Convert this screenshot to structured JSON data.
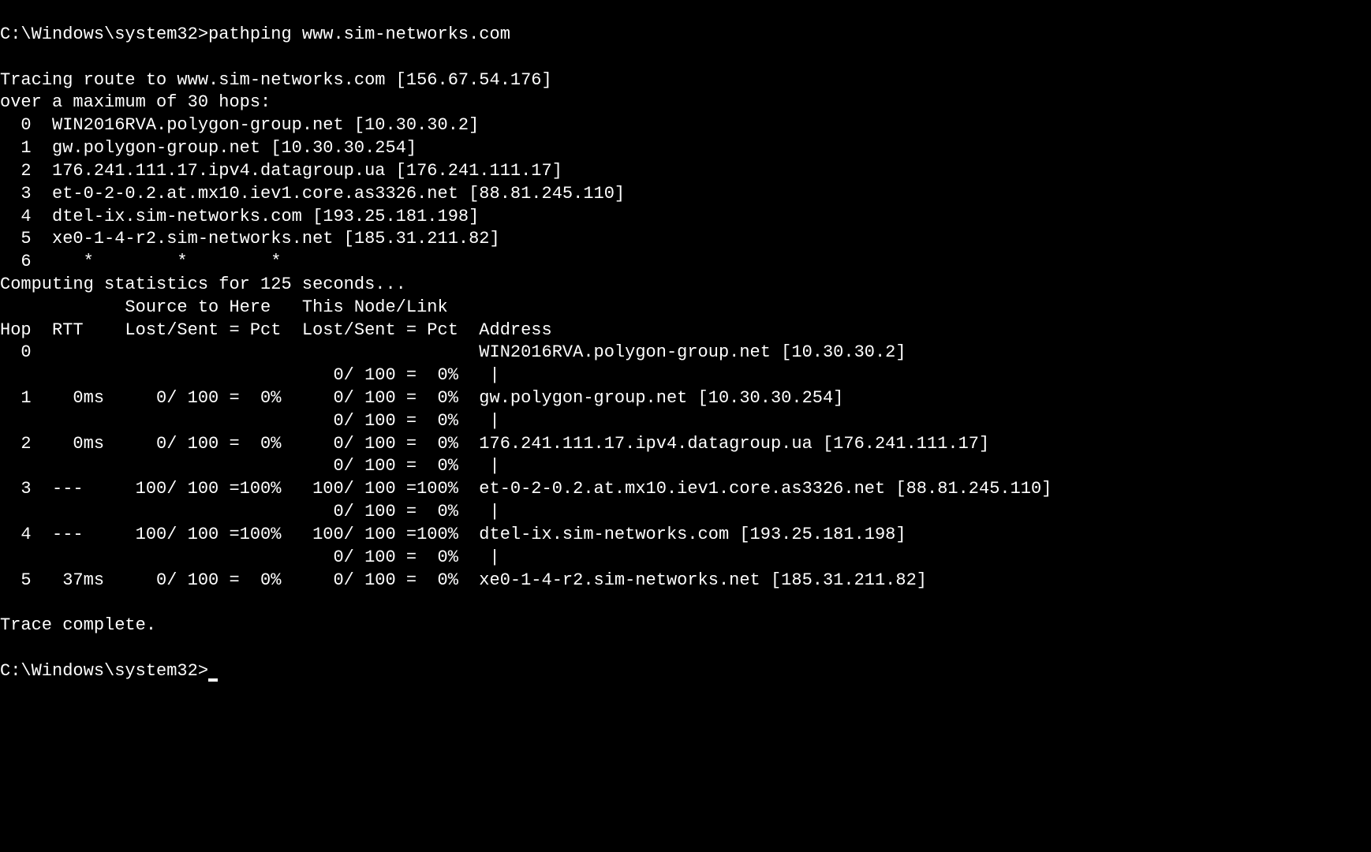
{
  "command": "pathping www.sim-networks.com",
  "lines": [
    "C:\\Windows\\system32>",
    "Tracing route to www.sim-networks.com [156.67.54.176]",
    "over a maximum of 30 hops:",
    "  0  WIN2016RVA.polygon-group.net [10.30.30.2]",
    "  1  gw.polygon-group.net [10.30.30.254]",
    "  2  176.241.111.17.ipv4.datagroup.ua [176.241.111.17]",
    "  3  et-0-2-0.2.at.mx10.iev1.core.as3326.net [88.81.245.110]",
    "  4  dtel-ix.sim-networks.com [193.25.181.198]",
    "  5  xe0-1-4-r2.sim-networks.net [185.31.211.82]",
    "  6     *        *        *",
    "Computing statistics for 125 seconds...",
    "            Source to Here   This Node/Link",
    "Hop  RTT    Lost/Sent = Pct  Lost/Sent = Pct  Address",
    "  0                                           WIN2016RVA.polygon-group.net [10.30.30.2]",
    "                                0/ 100 =  0%   |",
    "  1    0ms     0/ 100 =  0%     0/ 100 =  0%  gw.polygon-group.net [10.30.30.254]",
    "                                0/ 100 =  0%   |",
    "  2    0ms     0/ 100 =  0%     0/ 100 =  0%  176.241.111.17.ipv4.datagroup.ua [176.241.111.17]",
    "                                0/ 100 =  0%   |",
    "  3  ---     100/ 100 =100%   100/ 100 =100%  et-0-2-0.2.at.mx10.iev1.core.as3326.net [88.81.245.110]",
    "                                0/ 100 =  0%   |",
    "  4  ---     100/ 100 =100%   100/ 100 =100%  dtel-ix.sim-networks.com [193.25.181.198]",
    "                                0/ 100 =  0%   |",
    "  5   37ms     0/ 100 =  0%     0/ 100 =  0%  xe0-1-4-r2.sim-networks.net [185.31.211.82]",
    "Trace complete.",
    "C:\\Windows\\system32>"
  ],
  "trace": {
    "target_host": "www.sim-networks.com",
    "target_ip": "156.67.54.176",
    "max_hops": 30,
    "stats_seconds": 125,
    "hops": [
      {
        "n": 0,
        "host": "WIN2016RVA.polygon-group.net",
        "ip": "10.30.30.2"
      },
      {
        "n": 1,
        "host": "gw.polygon-group.net",
        "ip": "10.30.30.254"
      },
      {
        "n": 2,
        "host": "176.241.111.17.ipv4.datagroup.ua",
        "ip": "176.241.111.17"
      },
      {
        "n": 3,
        "host": "et-0-2-0.2.at.mx10.iev1.core.as3326.net",
        "ip": "88.81.245.110"
      },
      {
        "n": 4,
        "host": "dtel-ix.sim-networks.com",
        "ip": "193.25.181.198"
      },
      {
        "n": 5,
        "host": "xe0-1-4-r2.sim-networks.net",
        "ip": "185.31.211.82"
      },
      {
        "n": 6,
        "timeout": true
      }
    ],
    "stats": [
      {
        "hop": 0,
        "rtt": null,
        "src_lost": null,
        "src_sent": null,
        "src_pct": null,
        "node_lost": null,
        "node_sent": null,
        "node_pct": null,
        "address": "WIN2016RVA.polygon-group.net [10.30.30.2]",
        "link_lost": 0,
        "link_sent": 100,
        "link_pct": 0
      },
      {
        "hop": 1,
        "rtt": "0ms",
        "src_lost": 0,
        "src_sent": 100,
        "src_pct": 0,
        "node_lost": 0,
        "node_sent": 100,
        "node_pct": 0,
        "address": "gw.polygon-group.net [10.30.30.254]",
        "link_lost": 0,
        "link_sent": 100,
        "link_pct": 0
      },
      {
        "hop": 2,
        "rtt": "0ms",
        "src_lost": 0,
        "src_sent": 100,
        "src_pct": 0,
        "node_lost": 0,
        "node_sent": 100,
        "node_pct": 0,
        "address": "176.241.111.17.ipv4.datagroup.ua [176.241.111.17]",
        "link_lost": 0,
        "link_sent": 100,
        "link_pct": 0
      },
      {
        "hop": 3,
        "rtt": "---",
        "src_lost": 100,
        "src_sent": 100,
        "src_pct": 100,
        "node_lost": 100,
        "node_sent": 100,
        "node_pct": 100,
        "address": "et-0-2-0.2.at.mx10.iev1.core.as3326.net [88.81.245.110]",
        "link_lost": 0,
        "link_sent": 100,
        "link_pct": 0
      },
      {
        "hop": 4,
        "rtt": "---",
        "src_lost": 100,
        "src_sent": 100,
        "src_pct": 100,
        "node_lost": 100,
        "node_sent": 100,
        "node_pct": 100,
        "address": "dtel-ix.sim-networks.com [193.25.181.198]",
        "link_lost": 0,
        "link_sent": 100,
        "link_pct": 0
      },
      {
        "hop": 5,
        "rtt": "37ms",
        "src_lost": 0,
        "src_sent": 100,
        "src_pct": 0,
        "node_lost": 0,
        "node_sent": 100,
        "node_pct": 0,
        "address": "xe0-1-4-r2.sim-networks.net [185.31.211.82]"
      }
    ]
  }
}
